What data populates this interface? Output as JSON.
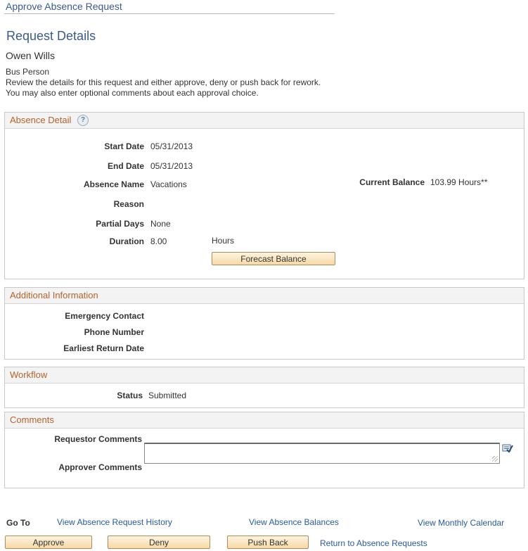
{
  "page": {
    "title": "Approve Absence Request",
    "heading": "Request Details",
    "employee_name": "Owen Wills",
    "job_title": "Bus Person",
    "instructions_line1": "Review the details for this request and either approve, deny or push back for rework.",
    "instructions_line2": "You may also enter optional comments about each approval choice."
  },
  "absence_detail": {
    "header": "Absence Detail",
    "help_icon": "help-icon",
    "start_date_label": "Start Date",
    "start_date": "05/31/2013",
    "end_date_label": "End Date",
    "end_date": "05/31/2013",
    "absence_name_label": "Absence Name",
    "absence_name": "Vacations",
    "current_balance_label": "Current Balance",
    "current_balance": "103.99 Hours**",
    "reason_label": "Reason",
    "partial_days_label": "Partial Days",
    "partial_days": "None",
    "duration_label": "Duration",
    "duration": "8.00",
    "duration_unit": "Hours",
    "forecast_button": "Forecast Balance"
  },
  "additional_info": {
    "header": "Additional Information",
    "emergency_contact_label": "Emergency Contact",
    "phone_number_label": "Phone Number",
    "earliest_return_label": "Earliest Return Date"
  },
  "workflow": {
    "header": "Workflow",
    "status_label": "Status",
    "status": "Submitted"
  },
  "comments": {
    "header": "Comments",
    "requestor_label": "Requestor Comments",
    "approver_label": "Approver Comments",
    "approver_value": "",
    "spellcheck_icon": "spell-check-icon"
  },
  "footer": {
    "goto_label": "Go To",
    "history_link": "View Absence Request History",
    "balances_link": "View Absence Balances",
    "calendar_link": "View Monthly Calendar",
    "approve_button": "Approve",
    "deny_button": "Deny",
    "pushback_button": "Push Back",
    "return_link": "Return to Absence Requests"
  },
  "colors": {
    "title_blue": "#3b5a8a",
    "section_header_orange": "#b4632e",
    "link_blue": "#2a5a9a",
    "button_fill": "#f6d9a6"
  }
}
